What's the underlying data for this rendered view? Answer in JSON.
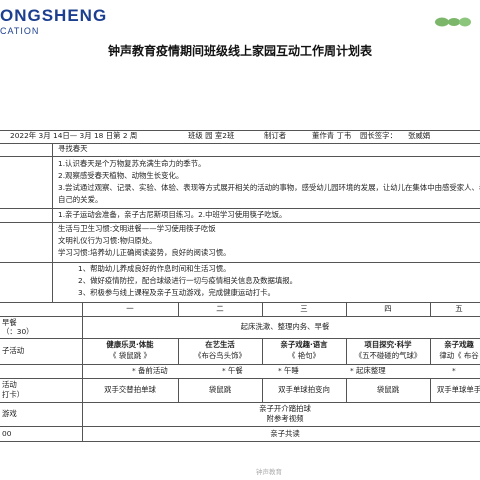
{
  "header": {
    "logo_main": "ONGSHENG",
    "logo_sub": "CATION",
    "title": "钟声教育疫情期间班级线上家园互动工作周计划表"
  },
  "info": {
    "date_line": "2022年 3月 14日— 3月 18 日第 2 周",
    "class_field": "班级 园 室2班",
    "maker_field": "制订者",
    "teacher_field": "董作青 丁韦",
    "principal_field": "园长签字：",
    "principal_name": "张威娟"
  },
  "theme": "寻找春天",
  "goals": [
    "1.认识春天是个万物复苏充满生命力的季节。",
    "2.观察感受春天植物、动物生长变化。",
    "3.尝试通过观察、记录、实验、体验、表现等方式展开相关的活动的事物，感受幼儿园环境的发展，让幼儿在集体中由感受家人、老师",
    "自己的关爱。"
  ],
  "parent_tasks": "1.亲子运动会准备，亲子古尼斯项目练习。2.中班学习使用筷子吃饭。",
  "habits": [
    "生活与卫生习惯:文明进餐——学习使用筷子吃饭",
    "文明礼仪行为习惯:物归原处。",
    "学习习惯:培养幼儿正确阅读姿势，良好的阅读习惯。"
  ],
  "health_notes": [
    "1、帮助幼儿养成良好的作息时间和生活习惯。",
    "2、做好疫情防控，配合球级进行一切与疫情相关信息及数据填报。",
    "3、积极参与线上课程及亲子互动游戏，完成健康运动打卡。"
  ],
  "schedule": {
    "weekdays": [
      "一",
      "二",
      "三",
      "四",
      "五"
    ],
    "early_label": "早餐",
    "early_time": "（：30）",
    "early_activity": "起床洗漱、整理内务、早餐",
    "lesson_label": "子活动",
    "lessons": [
      {
        "title": "健康乐灵·体能",
        "name": "《 袋鼠跳 》"
      },
      {
        "title": "在艺生活",
        "name": "《布谷鸟头饰》"
      },
      {
        "title": "亲子戏趣·语言",
        "name": "《 艳句》"
      },
      {
        "title": "项目探究·科学",
        "name": "《五不碰碰的气球》"
      },
      {
        "title": "亲子戏趣",
        "name": "律动《 布谷"
      }
    ],
    "prep_line": [
      "* 备前活动",
      "* 午餐",
      "* 午睡",
      "* 起床整理",
      "*"
    ],
    "sport_label_1": "活动",
    "sport_label_2": "打卡）",
    "sports": [
      "双手交替拍单球",
      "袋鼠跳",
      "双手单球拍变向",
      "袋鼠跳",
      "双手单球单手"
    ],
    "game_label": "游戏",
    "game_lines": [
      "亲子开介踏拍球",
      "附参考视频"
    ],
    "time_label": "00",
    "shared_read": "亲子共读"
  },
  "watermark": "钟声教育"
}
